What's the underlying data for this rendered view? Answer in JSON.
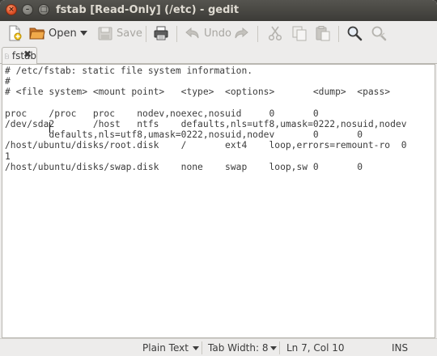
{
  "window": {
    "title": "fstab [Read-Only] (/etc) - gedit",
    "controls": {
      "close": "×",
      "minimize": "–",
      "maximize": "□"
    }
  },
  "toolbar": {
    "new_icon": "new-document-icon",
    "open_label": "Open",
    "open_icon": "open-folder-icon",
    "open_dropdown_icon": "chevron-down-icon",
    "save_label": "Save",
    "save_icon": "save-icon",
    "print_icon": "print-icon",
    "undo_label": "Undo",
    "undo_icon": "undo-icon",
    "redo_icon": "redo-icon",
    "cut_icon": "cut-icon",
    "copy_icon": "copy-icon",
    "paste_icon": "paste-icon",
    "find_icon": "find-icon",
    "replace_icon": "find-replace-icon"
  },
  "tabs": [
    {
      "label": "fstab",
      "icon": "document-icon",
      "close": "✖"
    }
  ],
  "editor": {
    "lines": [
      "# /etc/fstab: static file system information.",
      "#",
      "# <file system> <mount point>   <type>  <options>       <dump>  <pass>",
      "",
      "proc    /proc   proc    nodev,noexec,nosuid     0       0",
      "/dev/sda2       /host   ntfs    defaults,nls=utf8,umask=0222,nosuid,nodev",
      "        defaults,nls=utf8,umask=0222,nosuid,nodev       0       0",
      "/host/ubuntu/disks/root.disk    /       ext4    loop,errors=remount-ro  0",
      "1",
      "/host/ubuntu/disks/swap.disk    none    swap    loop,sw 0       0"
    ]
  },
  "statusbar": {
    "language": "Plain Text",
    "tab_width": "Tab Width:  8",
    "cursor_position": "Ln 7, Col 10",
    "insert_mode": "INS"
  },
  "colors": {
    "titlebar": "#3c3b37",
    "close_button": "#e0532a",
    "window_bg": "#edeceb",
    "editor_bg": "#ffffff",
    "text": "#3c3c3c"
  }
}
